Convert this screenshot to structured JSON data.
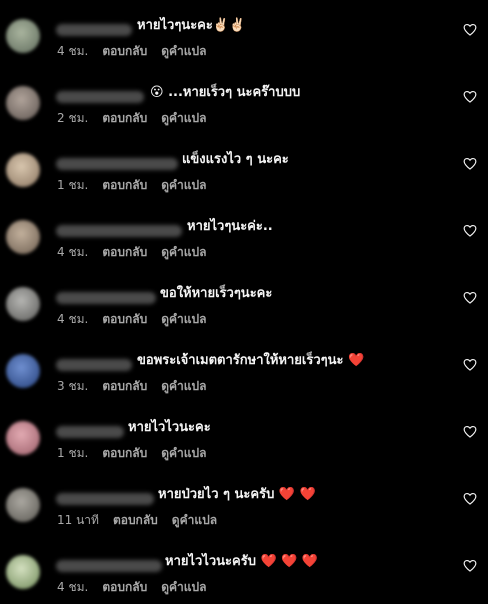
{
  "comments": [
    {
      "username": "(blurred)",
      "text": "หายไวๆนะคะ✌🏻✌🏻",
      "time": "4 ชม.",
      "reply": "ตอบกลับ",
      "translate": "ดูคำแปล",
      "avatar_color": "#7f8c7a"
    },
    {
      "username": "(blurred)",
      "text": "😮 ...หายเร็วๆ นะคร๊าบบบ",
      "time": "2 ชม.",
      "reply": "ตอบกลับ",
      "translate": "ดูคำแปล",
      "avatar_color": "#8c7f76"
    },
    {
      "username": "(blurred)",
      "text": "แข็งแรงไว ๆ นะคะ",
      "time": "1 ชม.",
      "reply": "ตอบกลับ",
      "translate": "ดูคำแปล",
      "avatar_color": "#b7a48e"
    },
    {
      "username": "(blurred)",
      "text": "หายไวๆนะค่ะ..",
      "time": "4 ชม.",
      "reply": "ตอบกลับ",
      "translate": "ดูคำแปล",
      "avatar_color": "#9b8b7a"
    },
    {
      "username": "(blurred)",
      "text": "ขอให้หายเร็วๆนะคะ",
      "time": "4 ชม.",
      "reply": "ตอบกลับ",
      "translate": "ดูคำแปล",
      "avatar_color": "#8a8a88"
    },
    {
      "username": "(blurred)",
      "text": "ขอพระเจ้าเมตตารักษาให้หายเร็วๆนะ ❤️",
      "time": "3 ชม.",
      "reply": "ตอบกลับ",
      "translate": "ดูคำแปล",
      "avatar_color": "#3b5a9a"
    },
    {
      "username": "(blurred)",
      "text": "หายไวไวนะคะ",
      "time": "1 ชม.",
      "reply": "ตอบกลับ",
      "translate": "ดูคำแปล",
      "avatar_color": "#c98b93"
    },
    {
      "username": "(blurred)",
      "text": "หายป่วยไว ๆ นะครับ ❤️ ❤️",
      "time": "11 นาที",
      "reply": "ตอบกลับ",
      "translate": "ดูคำแปล",
      "avatar_color": "#7c7a74"
    },
    {
      "username": "(blurred)",
      "text": "หายไวไวนะครับ ❤️ ❤️ ❤️",
      "time": "4 ชม.",
      "reply": "ตอบกลับ",
      "translate": "ดูคำแปล",
      "avatar_color": "#9fb08a"
    }
  ],
  "icons": {
    "like": "heart-outline-icon"
  },
  "colors": {
    "background": "#000000",
    "text": "#f5f5f5",
    "meta": "#a8a8a8"
  }
}
